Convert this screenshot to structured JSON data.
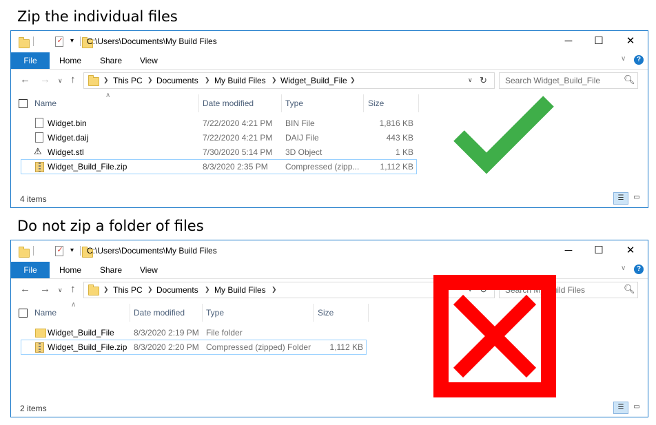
{
  "headings": {
    "top": "Zip the individual files",
    "bottom": "Do not zip a folder of files"
  },
  "window1": {
    "title": "C:\\Users\\Documents\\My Build Files",
    "tabs": {
      "file": "File",
      "home": "Home",
      "share": "Share",
      "view": "View"
    },
    "breadcrumbs": [
      "This PC",
      "Documents",
      "My Build Files",
      "Widget_Build_File"
    ],
    "search_placeholder": "Search Widget_Build_File",
    "columns": {
      "name": "Name",
      "date": "Date modified",
      "type": "Type",
      "size": "Size"
    },
    "rows": [
      {
        "name": "Widget.bin",
        "date": "7/22/2020 4:21 PM",
        "type": "BIN File",
        "size": "1,816 KB",
        "icon": "file-icon"
      },
      {
        "name": "Widget.daij",
        "date": "7/22/2020 4:21 PM",
        "type": "DAIJ File",
        "size": "443 KB",
        "icon": "file-icon"
      },
      {
        "name": "Widget.stl",
        "date": "7/30/2020 5:14 PM",
        "type": "3D Object",
        "size": "1 KB",
        "icon": "3d-object-icon"
      },
      {
        "name": "Widget_Build_File.zip",
        "date": "8/3/2020 2:35 PM",
        "type": "Compressed (zipp...",
        "size": "1,112 KB",
        "icon": "zip-icon"
      }
    ],
    "status": "4 items",
    "overlay": "green-checkmark-icon",
    "overlay_color": "#3fae49"
  },
  "window2": {
    "title": "C:\\Users\\Documents\\My Build Files",
    "tabs": {
      "file": "File",
      "home": "Home",
      "share": "Share",
      "view": "View"
    },
    "breadcrumbs": [
      "This PC",
      "Documents",
      "My Build Files"
    ],
    "search_placeholder": "Search My Build Files",
    "columns": {
      "name": "Name",
      "date": "Date modified",
      "type": "Type",
      "size": "Size"
    },
    "rows": [
      {
        "name": "Widget_Build_File",
        "date": "8/3/2020 2:19 PM",
        "type": "File folder",
        "size": "",
        "icon": "folder-icon"
      },
      {
        "name": "Widget_Build_File.zip",
        "date": "8/3/2020 2:20 PM",
        "type": "Compressed (zipped) Folder",
        "size": "1,112 KB",
        "icon": "zip-icon"
      }
    ],
    "status": "2 items",
    "overlay": "red-x-icon",
    "overlay_color": "#ff0000"
  },
  "colors": {
    "accent": "#1979ca",
    "selection_border": "#99d1ff"
  }
}
